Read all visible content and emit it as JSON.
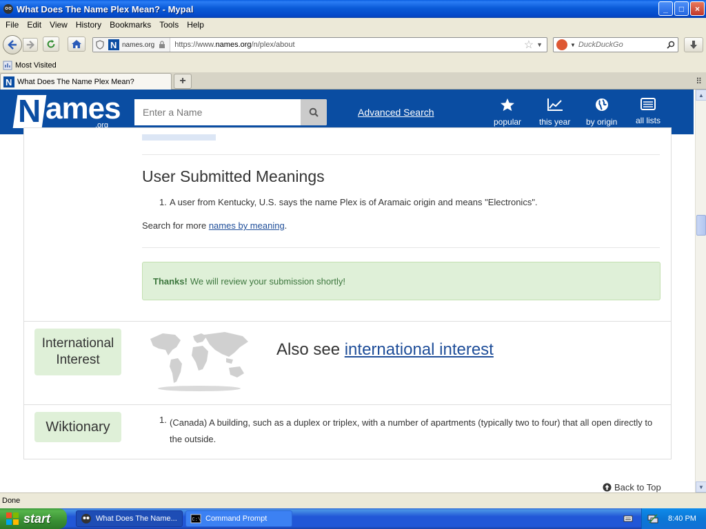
{
  "window": {
    "title": "What Does The Name Plex Mean? - Mypal",
    "minimize": "_",
    "maximize": "□",
    "close": "×"
  },
  "menu": [
    "File",
    "Edit",
    "View",
    "History",
    "Bookmarks",
    "Tools",
    "Help"
  ],
  "nav": {
    "site_identity": "names.org",
    "url_prefix": "https://www.",
    "url_domain": "names.org",
    "url_path": "/n/plex/about",
    "search_placeholder": "DuckDuckGo"
  },
  "bookmarks": {
    "most_visited": "Most Visited"
  },
  "tabs": [
    {
      "label": "What Does The Name Plex Mean?"
    }
  ],
  "site": {
    "logo_main": "ames",
    "logo_initial": "N",
    "logo_suffix": ".org",
    "search_placeholder": "Enter a Name",
    "advanced_search": "Advanced Search",
    "nav": [
      {
        "label": "popular",
        "icon": "star-icon"
      },
      {
        "label": "this year",
        "icon": "trend-chart-icon"
      },
      {
        "label": "by origin",
        "icon": "globe-icon"
      },
      {
        "label": "all lists",
        "icon": "list-icon"
      }
    ]
  },
  "content": {
    "user_meanings_heading": "User Submitted Meanings",
    "user_meanings": [
      {
        "num": "1.",
        "text": "A user from Kentucky, U.S. says the name Plex is of Aramaic origin and means \"Electronics\"."
      }
    ],
    "search_more_prefix": "Search for more ",
    "search_more_link": "names by meaning",
    "search_more_suffix": ".",
    "alert_bold": "Thanks!",
    "alert_text": "We will review your submission shortly!",
    "international_label": "International Interest",
    "also_see_prefix": "Also see ",
    "also_see_link": "international interest",
    "wiktionary_label": "Wiktionary",
    "wiktionary_items": [
      {
        "num": "1.",
        "text": "(Canada) A building, such as a duplex or triplex, with a number of apartments (typically two to four) that all open directly to the outside."
      }
    ],
    "back_to_top": "Back to Top"
  },
  "status": {
    "text": "Done"
  },
  "taskbar": {
    "start": "start",
    "tasks": [
      {
        "label": "What Does The Name...",
        "active": true
      },
      {
        "label": "Command Prompt",
        "active": false
      }
    ],
    "clock": "8:40 PM"
  },
  "colors": {
    "site_header": "#0A4DA2",
    "link": "#1F4E99",
    "alert_bg": "#DFF0D8",
    "alert_text": "#3C763D"
  }
}
